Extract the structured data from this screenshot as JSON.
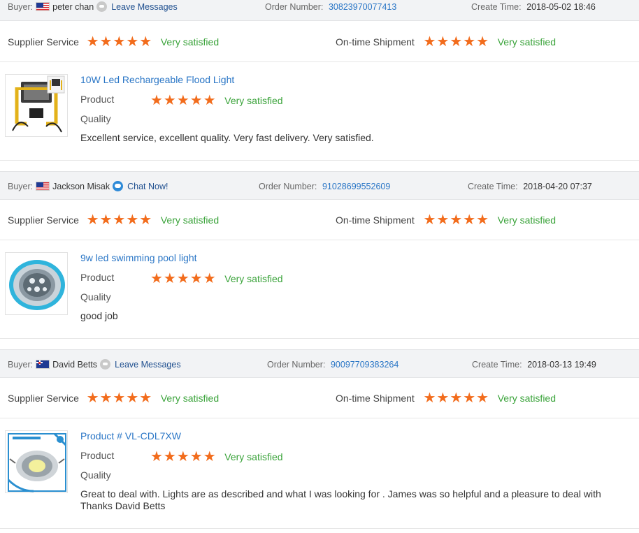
{
  "labels": {
    "buyer": "Buyer:",
    "order_number": "Order Number:",
    "create_time": "Create Time:",
    "supplier_service": "Supplier Service",
    "ontime_shipment": "On-time Shipment",
    "product": "Product",
    "quality": "Quality"
  },
  "colors": {
    "star": "#f26c1c",
    "satisfied": "#3aa33a",
    "link": "#2a76c6",
    "bar": "#f2f3f5"
  },
  "reviews": [
    {
      "buyer_name": "peter chan",
      "country_flag": "malaysia-flag-icon",
      "contact_label": "Leave Messages",
      "order_number": "30823970077413",
      "create_time": "2018-05-02 18:46",
      "supplier_rating": 5,
      "supplier_text": "Very satisfied",
      "shipment_rating": 5,
      "shipment_text": "Very satisfied",
      "product_name": "10W Led Rechargeable Flood Light",
      "product_rating": 5,
      "product_text": "Very satisfied",
      "comment": "Excellent service, excellent quality. Very fast delivery. Very satisfied."
    },
    {
      "buyer_name": "Jackson Misak",
      "country_flag": "malaysia-flag-icon",
      "contact_label": "Chat Now!",
      "order_number": "91028699552609",
      "create_time": "2018-04-20 07:37",
      "supplier_rating": 5,
      "supplier_text": "Very satisfied",
      "shipment_rating": 5,
      "shipment_text": "Very satisfied",
      "product_name": "9w led swimming pool light",
      "product_rating": 5,
      "product_text": "Very satisfied",
      "comment": "good job"
    },
    {
      "buyer_name": "David Betts",
      "country_flag": "australia-flag-icon",
      "contact_label": "Leave Messages",
      "order_number": "90097709383264",
      "create_time": "2018-03-13 19:49",
      "supplier_rating": 5,
      "supplier_text": "Very satisfied",
      "shipment_rating": 5,
      "shipment_text": "Very satisfied",
      "product_name": "Product # VL-CDL7XW",
      "product_rating": 5,
      "product_text": "Very satisfied",
      "comment": "Great to deal with. Lights are as described and what I was looking for . James was so helpful and a pleasure to deal with Thanks David Betts"
    }
  ]
}
